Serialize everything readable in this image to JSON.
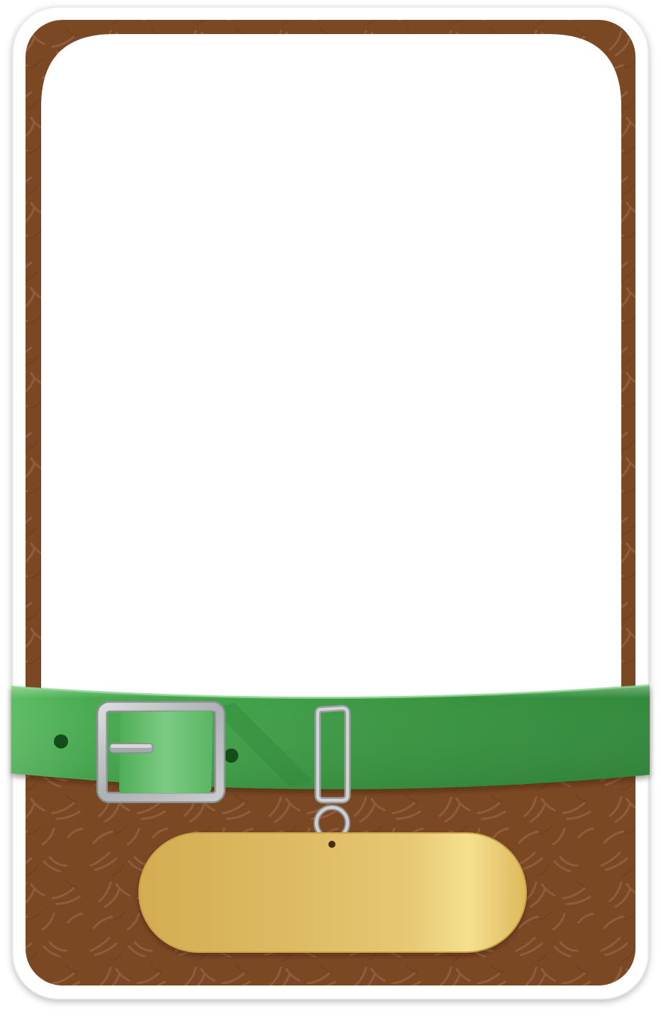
{
  "card": {
    "theme": "pet-collar-frame",
    "colors": {
      "card_border": "#ffffff",
      "fur": "#7b4824",
      "fur_stroke": "#9a6444",
      "photo_area": "#ffffff",
      "collar": "#3f9b46",
      "collar_light": "#6bc472",
      "buckle": "#b9bcbd",
      "name_tag": "#e2c06e"
    },
    "icons": {
      "buckle": "buckle-icon",
      "tag_ring": "ring-icon",
      "belt_loop": "belt-loop-icon"
    },
    "name_tag_text": ""
  }
}
